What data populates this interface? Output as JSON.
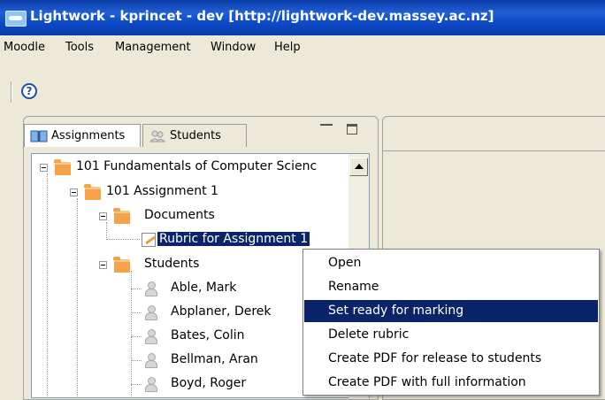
{
  "window": {
    "title": "Lightwork - kprincet - dev [http://lightwork-dev.massey.ac.nz]"
  },
  "menu": [
    "Moodle",
    "Tools",
    "Management",
    "Window",
    "Help"
  ],
  "toolbar": {
    "help_icon": "question-circle-icon",
    "help_glyph": "?"
  },
  "view": {
    "tabs": [
      {
        "label": "Assignments",
        "icon": "book-icon"
      },
      {
        "label": "Students",
        "icon": "students-icon"
      }
    ]
  },
  "tree": {
    "course": "101 Fundamentals of Computer Scienc",
    "assignment": "101 Assignment 1",
    "documents": "Documents",
    "rubric": "Rubric for Assignment 1",
    "students_folder": "Students",
    "students": [
      "Able, Mark",
      "Abplaner, Derek",
      "Bates, Colin",
      "Bellman, Aran",
      "Boyd, Roger"
    ]
  },
  "context_menu": {
    "items": [
      "Open",
      "Rename",
      "Set ready for marking",
      "Delete rubric",
      "Create PDF for release to students",
      "Create PDF with full information"
    ],
    "highlighted_index": 2
  },
  "colors": {
    "selection": "#0a246a",
    "titlebar": "#0b47c4",
    "folder": "#f5a24a"
  }
}
